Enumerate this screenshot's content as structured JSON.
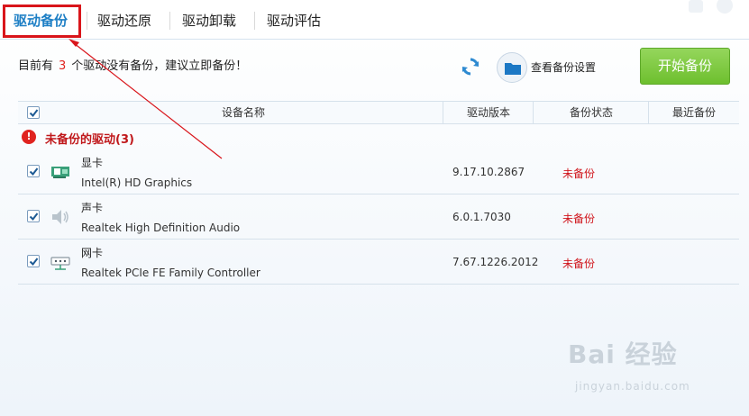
{
  "tabs": [
    {
      "label": "驱动备份",
      "active": true
    },
    {
      "label": "驱动还原",
      "active": false
    },
    {
      "label": "驱动卸载",
      "active": false
    },
    {
      "label": "驱动评估",
      "active": false
    }
  ],
  "info": {
    "prefix": "目前有",
    "count": "3",
    "suffix": "个驱动没有备份，建议立即备份！"
  },
  "toolbar": {
    "refresh_icon": "refresh-icon",
    "folder_icon": "folder-icon",
    "settings_label": "查看备份设置",
    "start_label": "开始备份",
    "start_color": "#7cc83c"
  },
  "table": {
    "columns": [
      "设备名称",
      "驱动版本",
      "备份状态",
      "最近备份"
    ]
  },
  "group": {
    "label": "未备份的驱动(3)"
  },
  "rows": [
    {
      "type": "显卡",
      "name": "Intel(R) HD Graphics",
      "version": "9.17.10.2867",
      "status": "未备份",
      "icon": "graphics-card-icon"
    },
    {
      "type": "声卡",
      "name": "Realtek High Definition Audio",
      "version": "6.0.1.7030",
      "status": "未备份",
      "icon": "speaker-icon"
    },
    {
      "type": "网卡",
      "name": "Realtek PCIe FE Family Controller",
      "version": "7.67.1226.2012",
      "status": "未备份",
      "icon": "network-card-icon"
    }
  ],
  "watermark": {
    "main": "Bai 经验",
    "sub": "jingyan.baidu.com"
  },
  "colors": {
    "accent": "#1e7fc5",
    "warning": "#e0231f",
    "annotation": "#d9151b"
  }
}
